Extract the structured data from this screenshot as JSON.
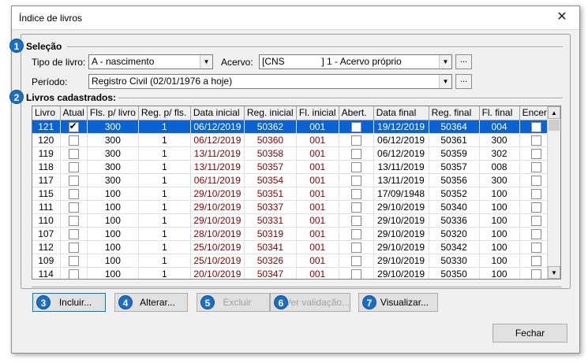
{
  "window": {
    "title": "Índice de livros",
    "close_glyph": "✕"
  },
  "selecao": {
    "badge": "1",
    "label": "Seleção",
    "tipo_label": "Tipo de livro:",
    "tipo_value": "A - nascimento",
    "acervo_label": "Acervo:",
    "acervo_value": "[CNS              ] 1 - Acervo próprio",
    "periodo_label": "Período:",
    "periodo_value": "Registro Civil (02/01/1976 a hoje)",
    "ellipsis": "..."
  },
  "livros": {
    "badge": "2",
    "label": "Livros cadastrados:",
    "columns": [
      "Livro",
      "Atual",
      "Fls. p/ livro",
      "Reg. p/ fls.",
      "Data inicial",
      "Reg. inicial",
      "Fl. inicial",
      "Abert.",
      "Data final",
      "Reg. final",
      "Fl. final",
      "Encer."
    ],
    "rows": [
      [
        "121",
        true,
        "300",
        "1",
        "06/12/2019",
        "50362",
        "001",
        false,
        "19/12/2019",
        "50364",
        "004",
        false
      ],
      [
        "120",
        false,
        "300",
        "1",
        "06/12/2019",
        "50360",
        "001",
        false,
        "06/12/2019",
        "50361",
        "300",
        false
      ],
      [
        "119",
        false,
        "300",
        "1",
        "13/11/2019",
        "50358",
        "001",
        false,
        "06/12/2019",
        "50359",
        "302",
        false
      ],
      [
        "118",
        false,
        "300",
        "1",
        "13/11/2019",
        "50357",
        "001",
        false,
        "13/11/2019",
        "50357",
        "008",
        false
      ],
      [
        "117",
        false,
        "300",
        "1",
        "06/11/2019",
        "50354",
        "001",
        false,
        "13/11/2019",
        "50356",
        "300",
        false
      ],
      [
        "115",
        false,
        "100",
        "1",
        "29/10/2019",
        "50351",
        "001",
        false,
        "17/09/1948",
        "50352",
        "100",
        false
      ],
      [
        "111",
        false,
        "100",
        "1",
        "29/10/2019",
        "50337",
        "001",
        false,
        "29/10/2019",
        "50340",
        "100",
        false
      ],
      [
        "110",
        false,
        "100",
        "1",
        "29/10/2019",
        "50331",
        "001",
        false,
        "29/10/2019",
        "50336",
        "100",
        false
      ],
      [
        "107",
        false,
        "100",
        "1",
        "28/10/2019",
        "50319",
        "001",
        false,
        "29/10/2019",
        "50320",
        "100",
        false
      ],
      [
        "112",
        false,
        "100",
        "1",
        "25/10/2019",
        "50341",
        "001",
        false,
        "29/10/2019",
        "50342",
        "100",
        false
      ],
      [
        "109",
        false,
        "100",
        "1",
        "25/10/2019",
        "50326",
        "001",
        false,
        "29/10/2019",
        "50330",
        "100",
        false
      ],
      [
        "114",
        false,
        "100",
        "1",
        "20/10/2019",
        "50347",
        "001",
        false,
        "29/10/2019",
        "50350",
        "100",
        false
      ]
    ]
  },
  "buttons": {
    "incluir": {
      "badge": "3",
      "label": "Incluir..."
    },
    "alterar": {
      "badge": "4",
      "label": "Alterar..."
    },
    "excluir": {
      "badge": "5",
      "label": "Excluir"
    },
    "ver_validacao": {
      "badge": "6",
      "label": "Ver validação..."
    },
    "visualizar": {
      "badge": "7",
      "label": "Visualizar..."
    },
    "fechar": {
      "label": "Fechar"
    }
  },
  "colors": {
    "selection": "#0a63d4",
    "badge": "#1a6fc4",
    "date_text": "#8b0000"
  }
}
